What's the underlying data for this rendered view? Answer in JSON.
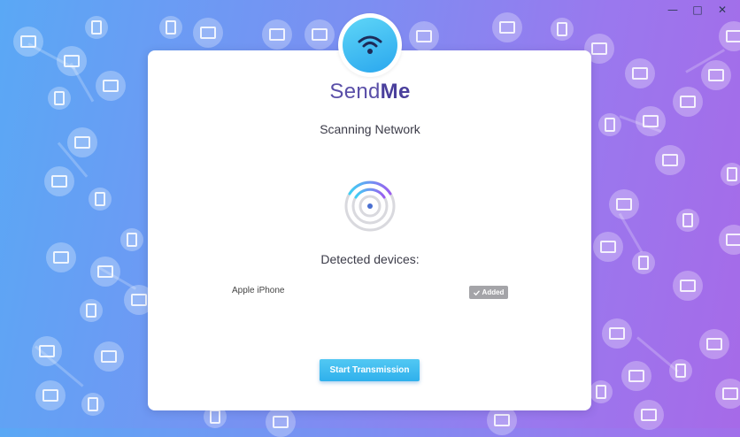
{
  "window": {
    "minimize_glyph": "—",
    "maximize_glyph": "□",
    "close_glyph": "✕"
  },
  "app": {
    "brand_part1": "Send",
    "brand_part2": "Me",
    "logo_icon": "wifi-icon"
  },
  "scan": {
    "title": "Scanning Network",
    "radar_icon": "wifi-radar-icon"
  },
  "devices": {
    "heading": "Detected devices:",
    "items": [
      {
        "name": "Apple iPhone",
        "status": "Added",
        "status_icon": "check-icon"
      }
    ]
  },
  "actions": {
    "start_label": "Start Transmission"
  },
  "colors": {
    "accent": "#2fb0ec",
    "brand": "#5a4fa8",
    "badge": "#a4a4a8"
  }
}
